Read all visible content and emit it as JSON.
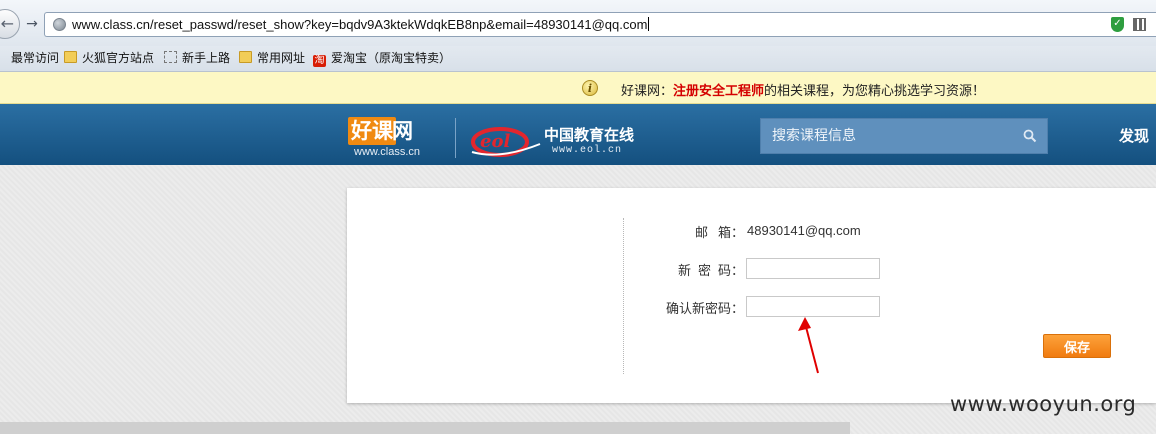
{
  "browser": {
    "url": "www.class.cn/reset_passwd/reset_show?key=bqdv9A3ktekWdqkEB8np&email=48930141@qq.com",
    "back_glyph": "←",
    "forward_glyph": "→"
  },
  "bookmarks": [
    {
      "label": "最常访问",
      "icon": "gear-icon"
    },
    {
      "label": "火狐官方站点",
      "icon": "folder-icon"
    },
    {
      "label": "新手上路",
      "icon": "page-icon"
    },
    {
      "label": "常用网址",
      "icon": "folder-icon"
    },
    {
      "label": "爱淘宝（原淘宝特卖）",
      "icon": "taobao-icon"
    }
  ],
  "notice": {
    "prefix": "好课网：",
    "highlight": "注册安全工程师",
    "suffix": "的相关课程，为您精心挑选学习资源！"
  },
  "header": {
    "logo_cn_box": "好课",
    "logo_cn_rest": "网",
    "logo_domain": "www.class.cn",
    "eol_name": "中国教育在线",
    "eol_url": "www.eol.cn",
    "search_placeholder": "搜索课程信息",
    "nav_discover": "发现"
  },
  "form": {
    "email_label": "邮箱：",
    "email_label_main": "邮箱",
    "email_value": "48930141@qq.com",
    "new_password_label": "新密码",
    "confirm_password_label": "确认新密码：",
    "colon": "：",
    "new_password_value": "",
    "confirm_password_value": "",
    "save_label": "保存"
  },
  "watermark": "www.wooyun.org",
  "colors": {
    "header_blue": "#1a5a8c",
    "accent_orange": "#f08a12",
    "notice_yellow": "#fdf8c4",
    "annotation_red": "#e00000"
  }
}
